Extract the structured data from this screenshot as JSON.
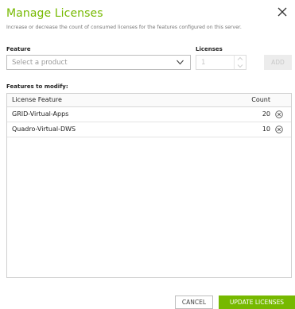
{
  "dialog": {
    "title": "Manage Licenses",
    "subtitle": "Increase or decrease the count of consumed licenses for the features configured on this server."
  },
  "form": {
    "feature_label": "Feature",
    "feature_placeholder": "Select a product",
    "licenses_label": "Licenses",
    "licenses_value": "1",
    "add_label": "ADD"
  },
  "table": {
    "section_label": "Features to modify:",
    "headers": {
      "feature": "License Feature",
      "count": "Count"
    },
    "rows": [
      {
        "feature": "GRID-Virtual-Apps",
        "count": "20"
      },
      {
        "feature": "Quadro-Virtual-DWS",
        "count": "10"
      }
    ]
  },
  "footer": {
    "cancel_label": "CANCEL",
    "update_label": "UPDATE LICENSES"
  },
  "colors": {
    "accent": "#76b900"
  }
}
